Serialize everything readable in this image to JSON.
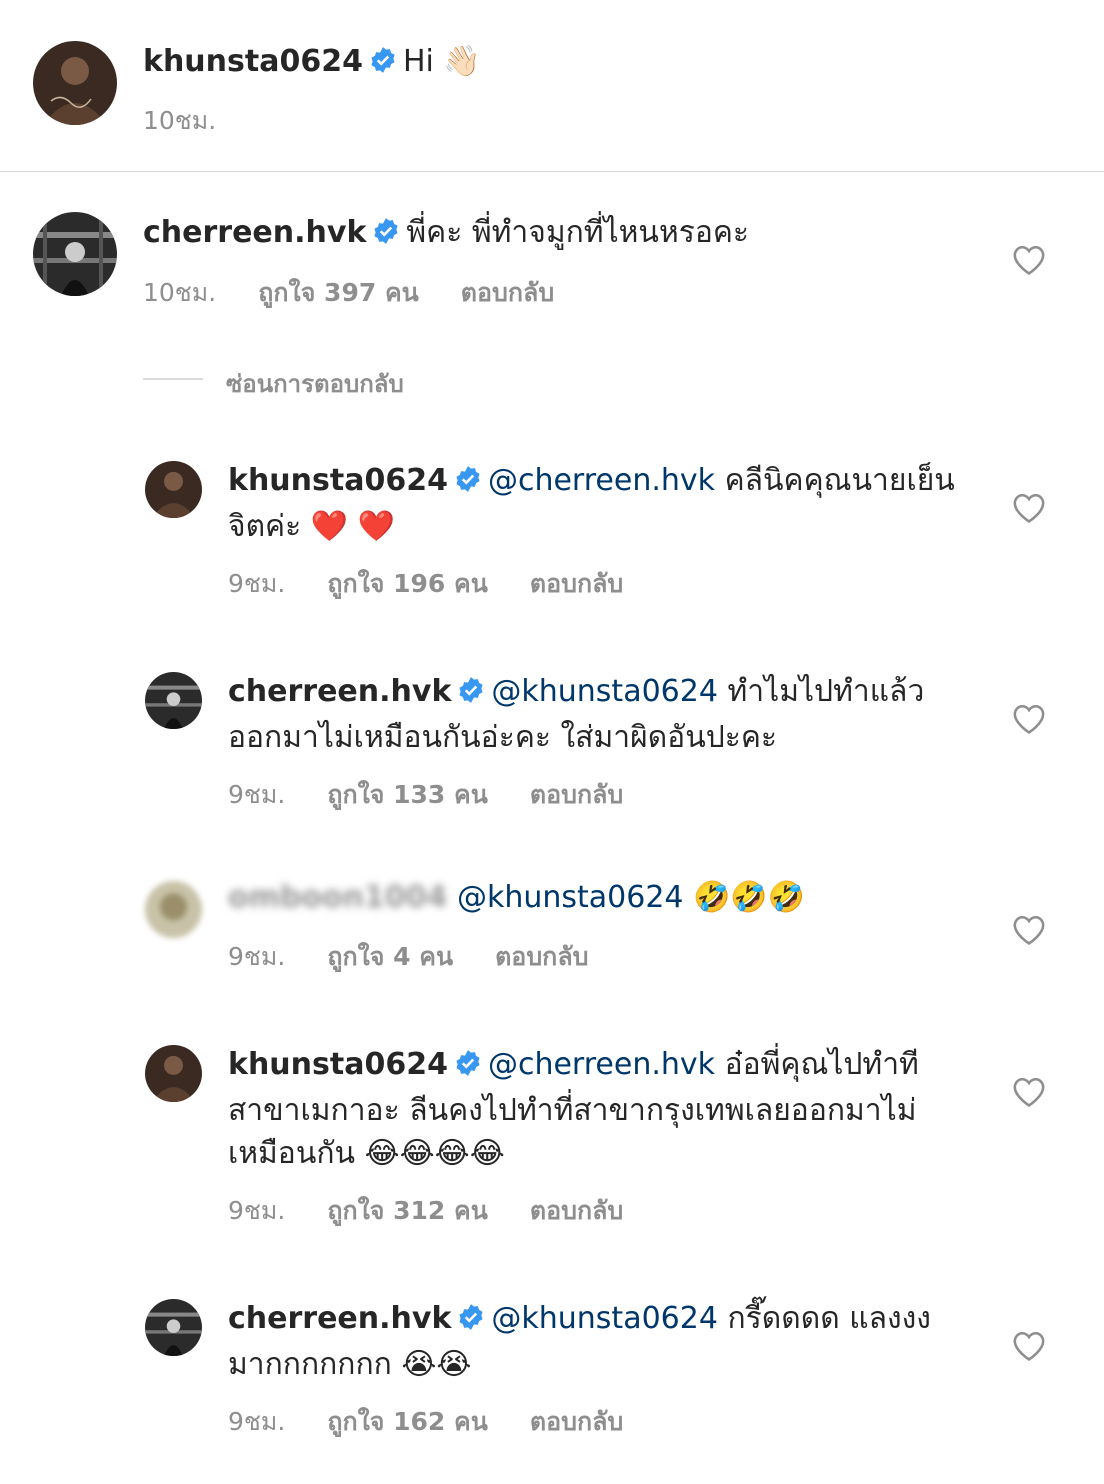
{
  "caption": {
    "username": "khunsta0624",
    "text": "Hi",
    "emoji": "👋🏻",
    "time": "10ชม."
  },
  "comment": {
    "username": "cherreen.hvk",
    "text": "พี่คะ พี่ทำจมูกที่ไหนหรอคะ",
    "time": "10ชม.",
    "likes": "ถูกใจ 397 คน",
    "reply": "ตอบกลับ"
  },
  "hide_replies": "ซ่อนการตอบกลับ",
  "replies": [
    {
      "username": "khunsta0624",
      "mention": "@cherreen.hvk",
      "text1": "คลีนิคคุณนายเย็น",
      "text2": "จิตค่ะ",
      "emoji": "❤️ ❤️",
      "time": "9ชม.",
      "likes": "ถูกใจ 196 คน",
      "reply": "ตอบกลับ"
    },
    {
      "username": "cherreen.hvk",
      "mention": "@khunsta0624",
      "text1": "ทำไมไปทำแล้ว",
      "text2": "ออกมาไม่เหมือนกันอ่ะคะ ใส่มาผิดอันปะคะ",
      "time": "9ชม.",
      "likes": "ถูกใจ 133 คน",
      "reply": "ตอบกลับ"
    },
    {
      "username": "omboon1004",
      "mention": "@khunsta0624",
      "emoji": "🤣🤣🤣",
      "time": "9ชม.",
      "likes": "ถูกใจ 4 คน",
      "reply": "ตอบกลับ"
    },
    {
      "username": "khunsta0624",
      "mention": "@cherreen.hvk",
      "text1": "อ๋อพี่คุณไปทำที",
      "text2": "สาขาเมกาอะ ลีนคงไปทำที่สาขากรุงเทพเลยออกมาไม่",
      "text3": "เหมือนกัน",
      "emoji": "😂😂😂😂",
      "time": "9ชม.",
      "likes": "ถูกใจ 312 คน",
      "reply": "ตอบกลับ"
    },
    {
      "username": "cherreen.hvk",
      "mention": "@khunsta0624",
      "text1": "กรี๊ดดดด แลงงง",
      "text2": "มากกกกกกก",
      "emoji": "😭😭",
      "time": "9ชม.",
      "likes": "ถูกใจ 162 คน",
      "reply": "ตอบกลับ"
    }
  ],
  "colors": {
    "verified": "#3897f0",
    "mention": "#00376b",
    "meta": "#8e8e8e"
  }
}
